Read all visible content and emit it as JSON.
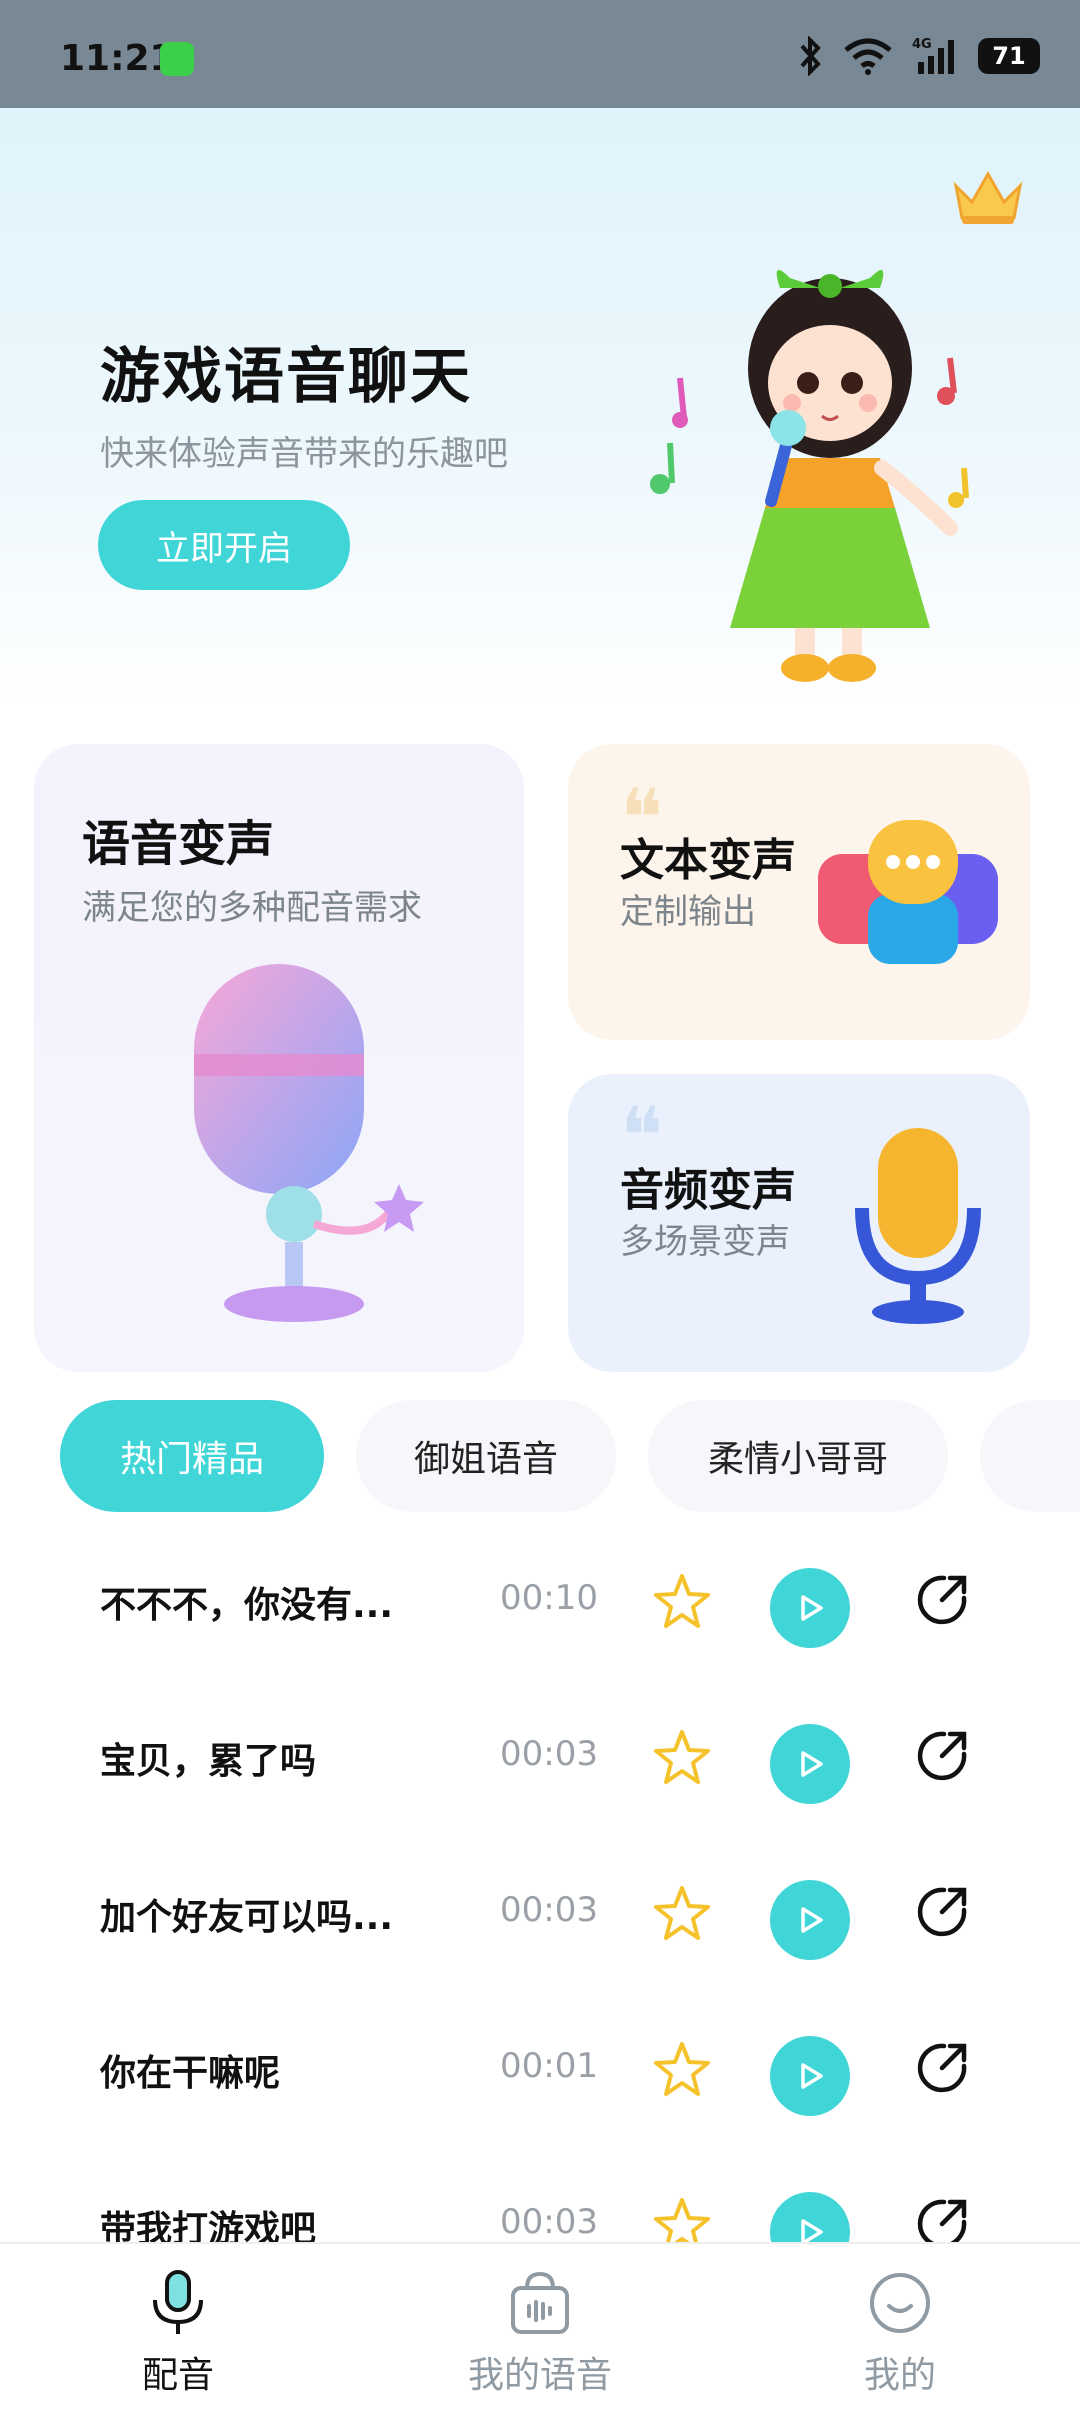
{
  "status_bar": {
    "time": "11:21",
    "battery": "71",
    "network": "4G"
  },
  "hero": {
    "title": "游戏语音聊天",
    "subtitle": "快来体验声音带来的乐趣吧",
    "cta": "立即开启"
  },
  "features": [
    {
      "title": "语音变声",
      "subtitle": "满足您的多种配音需求"
    },
    {
      "title": "文本变声",
      "subtitle": "定制输出"
    },
    {
      "title": "音频变声",
      "subtitle": "多场景变声"
    }
  ],
  "tabs": [
    {
      "label": "热门精品",
      "active": true
    },
    {
      "label": "御姐语音",
      "active": false
    },
    {
      "label": "柔情小哥哥",
      "active": false
    }
  ],
  "voice_list": [
    {
      "name": "不不不，你没有...",
      "duration": "00:10"
    },
    {
      "name": "宝贝，累了吗",
      "duration": "00:03"
    },
    {
      "name": "加个好友可以吗...",
      "duration": "00:03"
    },
    {
      "name": "你在干嘛呢",
      "duration": "00:01"
    },
    {
      "name": "带我打游戏吧",
      "duration": "00:03"
    }
  ],
  "bottom_nav": [
    {
      "label": "配音",
      "active": true,
      "icon": "microphone-icon"
    },
    {
      "label": "我的语音",
      "active": false,
      "icon": "voice-bag-icon"
    },
    {
      "label": "我的",
      "active": false,
      "icon": "smile-face-icon"
    }
  ],
  "colors": {
    "accent": "#40d6d8",
    "star": "#f6c22b",
    "text_muted": "#8c959d"
  }
}
